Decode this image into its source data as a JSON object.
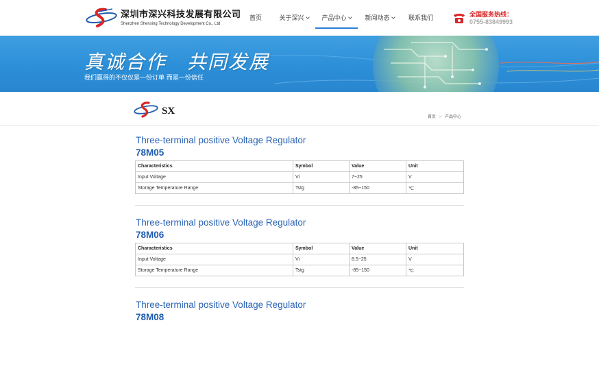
{
  "header": {
    "company_cn": "深圳市深兴科技发展有限公司",
    "company_en": "Shenzhen Shenxing Technology Development Co., Ltd",
    "nav": [
      {
        "label": "首页",
        "has_dropdown": false
      },
      {
        "label": "关于深兴",
        "has_dropdown": true
      },
      {
        "label": "产品中心",
        "has_dropdown": true,
        "active": true
      },
      {
        "label": "新闻动态",
        "has_dropdown": true
      },
      {
        "label": "联系我们",
        "has_dropdown": false
      }
    ],
    "hotline_label": "全国服务热线：",
    "hotline_number": "0755-83849993"
  },
  "banner": {
    "headline": "真诚合作　共同发展",
    "tagline": "我们赢得的不仅仅是一份订单 而是一份信任"
  },
  "subheader": {
    "logo_text": "SX",
    "breadcrumb": [
      "首页",
      "产品中心"
    ]
  },
  "products": [
    {
      "title": "Three-terminal positive Voltage Regulator",
      "model": "78M05",
      "headers": [
        "Characteristics",
        "Symbol",
        "Value",
        "Unit"
      ],
      "rows": [
        [
          "Input Voltage",
          "Vi",
          "7~25",
          "V"
        ],
        [
          "Storage Temperature Range",
          "Tstg",
          "-85~150",
          "℃"
        ]
      ]
    },
    {
      "title": "Three-terminal positive Voltage Regulator",
      "model": "78M06",
      "headers": [
        "Characteristics",
        "Symbol",
        "Value",
        "Unit"
      ],
      "rows": [
        [
          "Input Voltage",
          "Vi",
          "8.5~25",
          "V"
        ],
        [
          "Storage Temperature Range",
          "Tstg",
          "-85~150",
          "℃"
        ]
      ]
    },
    {
      "title": "Three-terminal positive Voltage Regulator",
      "model": "78M08"
    }
  ],
  "colors": {
    "accent": "#2a7fd6",
    "title_blue": "#2a63b5",
    "hotline_red": "#d92626",
    "banner_blue": "#2c8fd8"
  }
}
